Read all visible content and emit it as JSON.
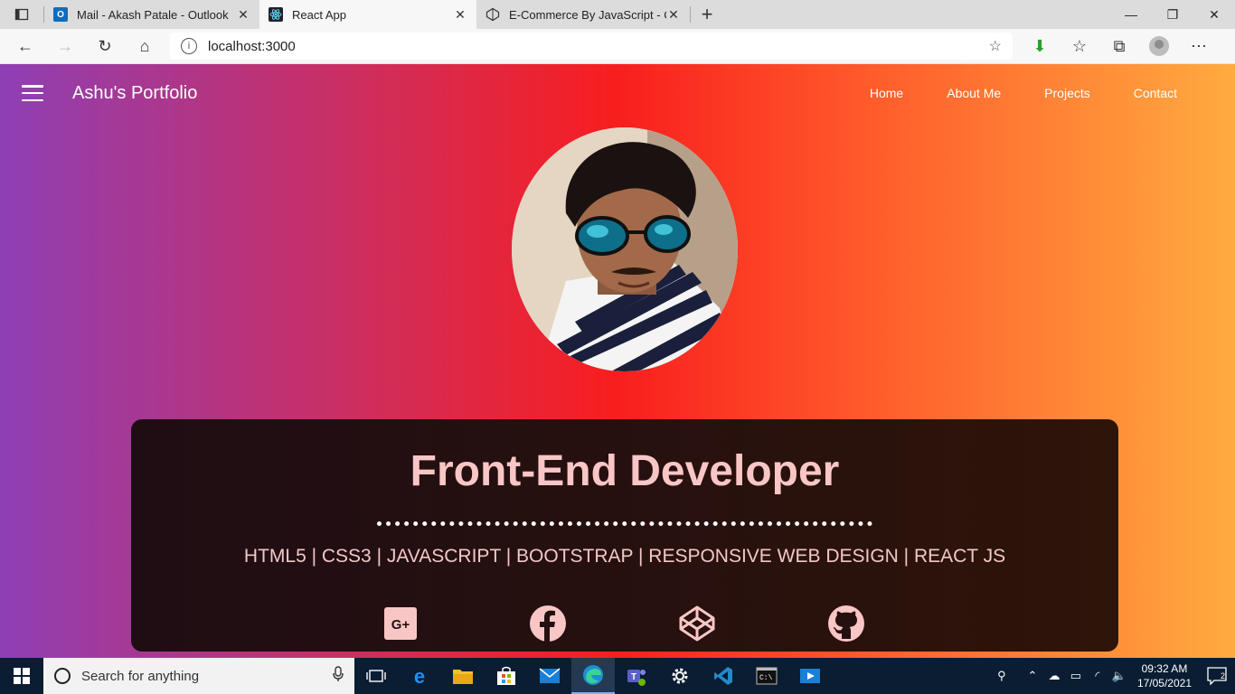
{
  "browser": {
    "tabs": [
      {
        "title": "Mail - Akash Patale - Outlook",
        "icon": "outlook-icon"
      },
      {
        "title": "React App",
        "icon": "react-icon",
        "active": true
      },
      {
        "title": "E-Commerce By JavaScript - Cod",
        "icon": "codepen-icon"
      }
    ],
    "url": "localhost:3000"
  },
  "site": {
    "brand": "Ashu's Portfolio",
    "nav": [
      "Home",
      "About Me",
      "Projects",
      "Contact"
    ],
    "headline": "Front-End Developer",
    "skills": "HTML5 | CSS3 | JAVASCRIPT | BOOTSTRAP | RESPONSIVE WEB DESIGN | REACT JS",
    "socials": [
      "google-plus-icon",
      "facebook-icon",
      "codepen-icon",
      "github-icon"
    ]
  },
  "taskbar": {
    "search_placeholder": "Search for anything",
    "time": "09:32 AM",
    "date": "17/05/2021",
    "notifications": "2"
  },
  "colors": {
    "gradient_left": "#8e3fb4",
    "gradient_mid": "#f81e1e",
    "gradient_right": "#ffab40",
    "card_bg": "#24100f",
    "headline_color": "#f9c6c6"
  }
}
